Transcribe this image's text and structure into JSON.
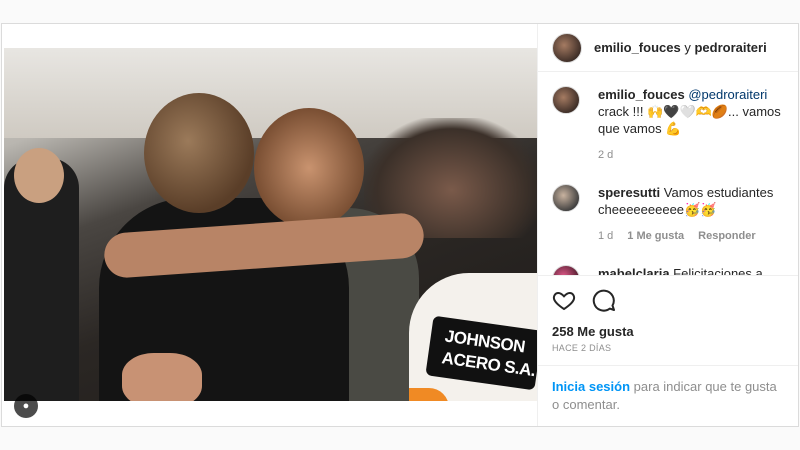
{
  "header": {
    "user1": "emilio_fouces",
    "connector": "y",
    "user2": "pedroraiteri"
  },
  "comments": [
    {
      "user": "emilio_fouces",
      "mention": "@pedroraiteri",
      "text": " crack !!! 🙌🖤🤍🫶🏉... vamos que vamos 💪",
      "time": "2 d",
      "likes": "",
      "reply": ""
    },
    {
      "user": "speresutti",
      "mention": "",
      "text": " Vamos estudiantes cheeeeeeeeee🥳🥳",
      "time": "1 d",
      "likes": "1 Me gusta",
      "reply": "Responder"
    },
    {
      "user": "mabelclaria",
      "mention": "",
      "text": " Felicitaciones a Emilio y Pedro, al equipo maravilloso de",
      "time": "",
      "likes": "",
      "reply": ""
    }
  ],
  "photo": {
    "sponsor_text": "JOHNSON ACERO S.A."
  },
  "actions": {
    "likes": "258 Me gusta",
    "ago": "HACE 2 DÍAS"
  },
  "login": {
    "link": "Inicia sesión",
    "text": " para indicar que te gusta o comentar."
  },
  "icons": {
    "heart": "heart-icon",
    "comment": "comment-icon",
    "user_tag": "user-tag-icon"
  }
}
